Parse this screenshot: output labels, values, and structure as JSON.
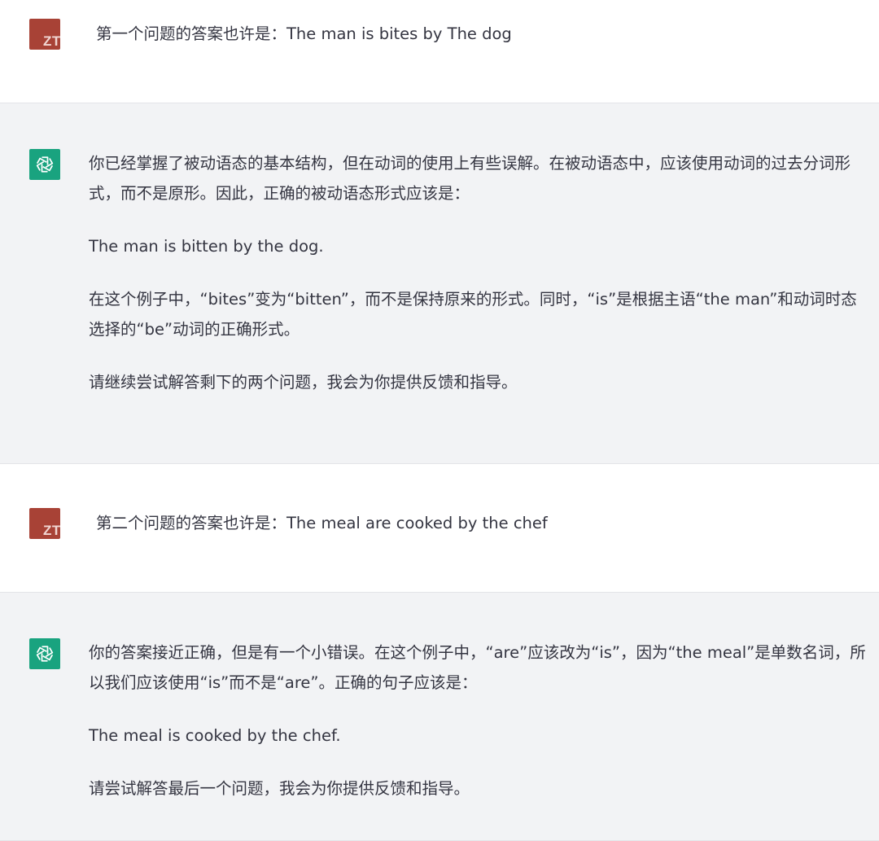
{
  "conversation": {
    "messages": [
      {
        "role": "user",
        "avatar_initials": "ZT",
        "text": "第一个问题的答案也许是：The man is bites by The dog"
      },
      {
        "role": "assistant",
        "avatar_icon": "openai-logo-icon",
        "paragraphs": [
          "你已经掌握了被动语态的基本结构，但在动词的使用上有些误解。在被动语态中，应该使用动词的过去分词形式，而不是原形。因此，正确的被动语态形式应该是：",
          "The man is bitten by the dog.",
          "在这个例子中，“bites”变为“bitten”，而不是保持原来的形式。同时，“is”是根据主语“the man”和动词时态选择的“be”动词的正确形式。",
          "请继续尝试解答剩下的两个问题，我会为你提供反馈和指导。"
        ]
      },
      {
        "role": "user",
        "avatar_initials": "ZT",
        "text": "第二个问题的答案也许是：The meal are cooked by the chef"
      },
      {
        "role": "assistant",
        "avatar_icon": "openai-logo-icon",
        "paragraphs": [
          "你的答案接近正确，但是有一个小错误。在这个例子中，“are”应该改为“is”，因为“the meal”是单数名词，所以我们应该使用“is”而不是“are”。正确的句子应该是：",
          "The meal is cooked by the chef.",
          "请尝试解答最后一个问题，我会为你提供反馈和指导。"
        ]
      }
    ]
  },
  "colors": {
    "user_avatar_bg": "#a84236",
    "assistant_avatar_bg": "#19a37f",
    "assistant_block_bg": "#f2f3f5",
    "text": "#343541"
  }
}
